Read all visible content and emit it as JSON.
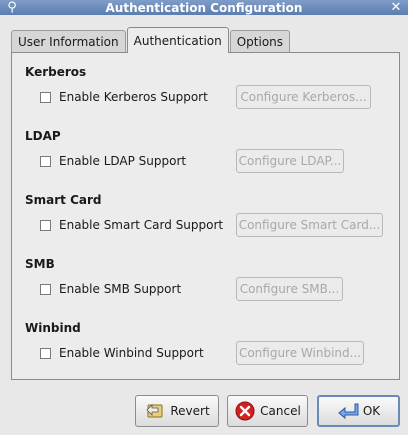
{
  "window": {
    "title": "Authentication Configuration"
  },
  "tabs": [
    {
      "label": "User Information",
      "active": false
    },
    {
      "label": "Authentication",
      "active": true
    },
    {
      "label": "Options",
      "active": false
    }
  ],
  "sections": {
    "kerberos": {
      "title": "Kerberos",
      "checkbox": "Enable Kerberos Support",
      "button": "Configure Kerberos..."
    },
    "ldap": {
      "title": "LDAP",
      "checkbox": "Enable LDAP Support",
      "button": "Configure LDAP..."
    },
    "smartcard": {
      "title": "Smart Card",
      "checkbox": "Enable Smart Card Support",
      "button": "Configure Smart Card..."
    },
    "smb": {
      "title": "SMB",
      "checkbox": "Enable SMB Support",
      "button": "Configure SMB..."
    },
    "winbind": {
      "title": "Winbind",
      "checkbox": "Enable Winbind Support",
      "button": "Configure Winbind..."
    }
  },
  "buttons": {
    "revert": "Revert",
    "cancel": "Cancel",
    "ok": "OK"
  },
  "colors": {
    "titlebar": "#6a8ab8",
    "disabled_text": "#a8a8a8",
    "cancel_icon": "#d42020",
    "ok_icon": "#3a6fc4"
  }
}
